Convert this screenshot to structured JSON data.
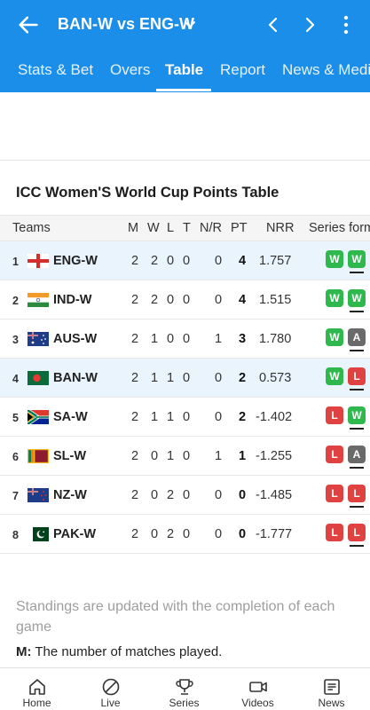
{
  "header": {
    "title": "BAN-W vs ENG-W",
    "icons": [
      "back-arrow-icon",
      "chevron-down-icon",
      "chevron-left-icon",
      "chevron-right-icon",
      "more-vertical-icon"
    ]
  },
  "tabs": [
    {
      "label": ""
    },
    {
      "label": "Stats & Bet"
    },
    {
      "label": "Overs"
    },
    {
      "label": "Table",
      "active": true
    },
    {
      "label": "Report"
    },
    {
      "label": "News & Media"
    }
  ],
  "table": {
    "title": "ICC Women'S World Cup Points Table",
    "columns": {
      "teams": "Teams",
      "m": "M",
      "w": "W",
      "l": "L",
      "t": "T",
      "nr": "N/R",
      "pt": "PT",
      "nrr": "NRR",
      "form": "Series form"
    },
    "rows": [
      {
        "pos": "1",
        "team": "ENG-W",
        "m": "2",
        "w": "2",
        "l": "0",
        "t": "0",
        "nr": "0",
        "pt": "4",
        "nrr": "1.757",
        "form": [
          "W",
          "W"
        ],
        "highlight": true
      },
      {
        "pos": "2",
        "team": "IND-W",
        "m": "2",
        "w": "2",
        "l": "0",
        "t": "0",
        "nr": "0",
        "pt": "4",
        "nrr": "1.515",
        "form": [
          "W",
          "W"
        ],
        "highlight": false
      },
      {
        "pos": "3",
        "team": "AUS-W",
        "m": "2",
        "w": "1",
        "l": "0",
        "t": "0",
        "nr": "1",
        "pt": "3",
        "nrr": "1.780",
        "form": [
          "W",
          "A"
        ],
        "highlight": false
      },
      {
        "pos": "4",
        "team": "BAN-W",
        "m": "2",
        "w": "1",
        "l": "1",
        "t": "0",
        "nr": "0",
        "pt": "2",
        "nrr": "0.573",
        "form": [
          "W",
          "L"
        ],
        "highlight": true
      },
      {
        "pos": "5",
        "team": "SA-W",
        "m": "2",
        "w": "1",
        "l": "1",
        "t": "0",
        "nr": "0",
        "pt": "2",
        "nrr": "-1.402",
        "form": [
          "L",
          "W"
        ],
        "highlight": false
      },
      {
        "pos": "6",
        "team": "SL-W",
        "m": "2",
        "w": "0",
        "l": "1",
        "t": "0",
        "nr": "1",
        "pt": "1",
        "nrr": "-1.255",
        "form": [
          "L",
          "A"
        ],
        "highlight": false
      },
      {
        "pos": "7",
        "team": "NZ-W",
        "m": "2",
        "w": "0",
        "l": "2",
        "t": "0",
        "nr": "0",
        "pt": "0",
        "nrr": "-1.485",
        "form": [
          "L",
          "L"
        ],
        "highlight": false
      },
      {
        "pos": "8",
        "team": "PAK-W",
        "m": "2",
        "w": "0",
        "l": "2",
        "t": "0",
        "nr": "0",
        "pt": "0",
        "nrr": "-1.777",
        "form": [
          "L",
          "L"
        ],
        "highlight": false
      }
    ]
  },
  "notes": {
    "standings": "Standings are updated with the completion of each game",
    "m_key": "M:",
    "m_desc": " The number of matches played."
  },
  "bottom_nav": [
    {
      "label": "Home",
      "icon": "home-icon"
    },
    {
      "label": "Live",
      "icon": "live-ball-icon"
    },
    {
      "label": "Series",
      "icon": "trophy-icon"
    },
    {
      "label": "Videos",
      "icon": "video-camera-icon"
    },
    {
      "label": "News",
      "icon": "news-icon"
    }
  ],
  "colors": {
    "brand": "#1a8ee8",
    "win": "#2fb84e",
    "loss": "#e04242",
    "abandoned": "#6a6a6a",
    "highlight_row": "#e9f4fd"
  }
}
